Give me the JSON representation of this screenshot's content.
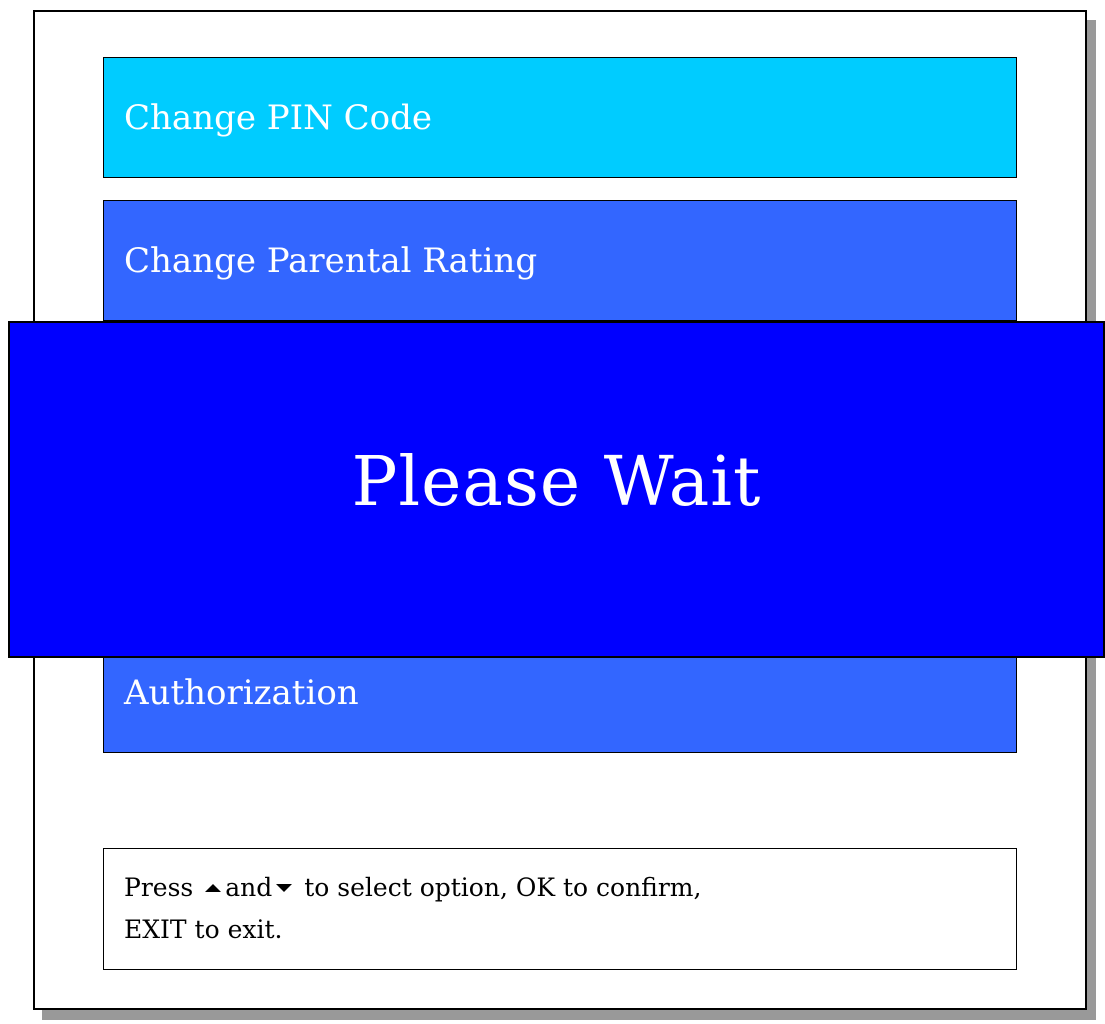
{
  "menu": {
    "items": [
      {
        "label": "Change PIN Code",
        "state": "selected",
        "color": "#00ccff"
      },
      {
        "label": "Change Parental Rating",
        "state": "normal",
        "color": "#3366ff"
      },
      {
        "label": "Authorization",
        "state": "normal",
        "color": "#3366ff"
      }
    ]
  },
  "overlay": {
    "message": "Please Wait",
    "color": "#0000ff"
  },
  "help": {
    "line1_press": "Press",
    "line1_and": "and",
    "line1_rest": "to select option, OK to confirm,",
    "line2": "EXIT to exit.",
    "up_icon": "up-triangle-icon",
    "down_icon": "down-triangle-icon"
  }
}
